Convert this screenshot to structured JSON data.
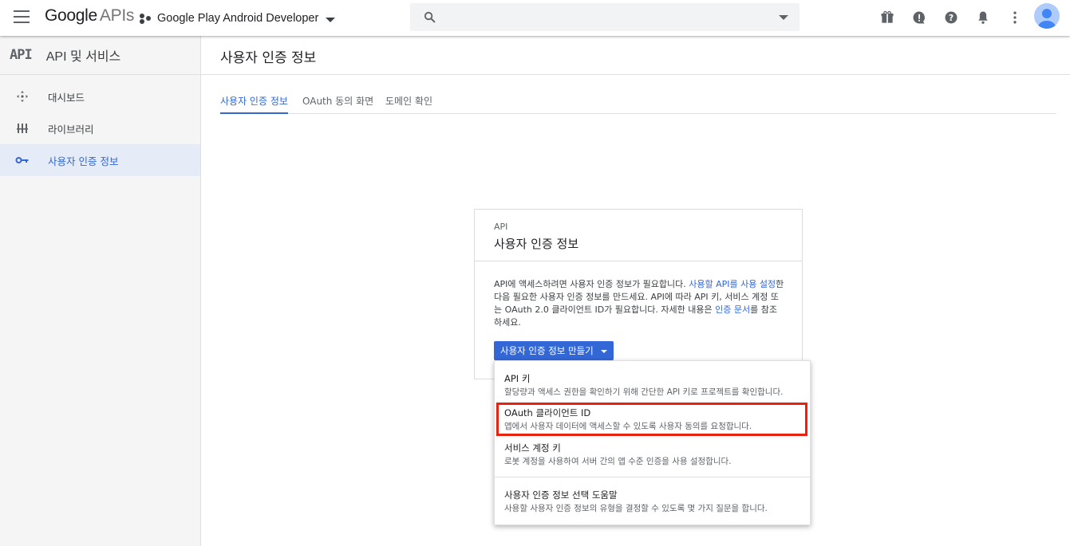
{
  "header": {
    "logo_google": "Google",
    "logo_apis": "APIs",
    "project_name": "Google Play Android Developer",
    "icons": [
      "menu-icon",
      "search-icon",
      "gift-icon",
      "feedback-icon",
      "help-icon",
      "notifications-icon",
      "more-vert-icon",
      "account-icon"
    ]
  },
  "sidebar": {
    "api_mark": "API",
    "title": "API 및 서비스",
    "items": [
      {
        "label": "대시보드",
        "icon": "dashboard-icon"
      },
      {
        "label": "라이브러리",
        "icon": "library-icon"
      },
      {
        "label": "사용자 인증 정보",
        "icon": "key-icon",
        "active": true
      }
    ]
  },
  "page": {
    "title": "사용자 인증 정보",
    "tabs": [
      {
        "label": "사용자 인증 정보",
        "active": true
      },
      {
        "label": "OAuth 동의 화면"
      },
      {
        "label": "도메인 확인"
      }
    ]
  },
  "card": {
    "kicker": "API",
    "title": "사용자 인증 정보",
    "body_1": "API에 액세스하려면 사용자 인증 정보가 필요합니다. ",
    "link_1": "사용할 API를 사용 설정",
    "body_2": "한 다음 필요한 사용자 인증 정보를 만드세요. API에 따라 API 키, 서비스 계정 또는 OAuth 2.0 클라이언트 ID가 필요합니다. 자세한 내용은 ",
    "link_2": "인증 문서",
    "body_3": "를 참조하세요.",
    "button_label": "사용자 인증 정보 만들기"
  },
  "menu": {
    "items": [
      {
        "title": "API 키",
        "desc": "할당량과 액세스 권한을 확인하기 위해 간단한 API 키로 프로젝트를 확인합니다."
      },
      {
        "title": "OAuth 클라이언트 ID",
        "desc": "앱에서 사용자 데이터에 액세스할 수 있도록 사용자 동의를 요청합니다.",
        "highlighted": true
      },
      {
        "title": "서비스 계정 키",
        "desc": "로봇 계정을 사용하여 서버 간의 앱 수준 인증을 사용 설정합니다."
      },
      {
        "title": "사용자 인증 정보 선택 도움말",
        "desc": "사용할 사용자 인증 정보의 유형을 결정할 수 있도록 몇 가지 질문을 합니다."
      }
    ]
  },
  "colors": {
    "accent": "#3367d6",
    "highlight": "#e8220f",
    "sidebar_bg": "#f5f5f5",
    "active_bg": "#e6ecf7"
  }
}
